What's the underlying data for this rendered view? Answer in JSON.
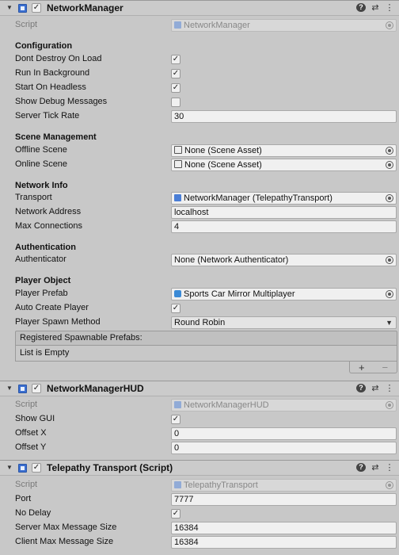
{
  "network_manager": {
    "title": "NetworkManager",
    "script_label": "Script",
    "script_value": "NetworkManager",
    "configuration": {
      "title": "Configuration",
      "dont_destroy_on_load": "Dont Destroy On Load",
      "run_in_background": "Run In Background",
      "start_on_headless": "Start On Headless",
      "show_debug_messages": "Show Debug Messages",
      "server_tick_rate": "Server Tick Rate",
      "server_tick_rate_value": "30",
      "checked_mark": "✓"
    },
    "scene_management": {
      "title": "Scene Management",
      "offline_scene": "Offline Scene",
      "offline_scene_value": "None (Scene Asset)",
      "online_scene": "Online Scene",
      "online_scene_value": "None (Scene Asset)"
    },
    "network_info": {
      "title": "Network Info",
      "transport": "Transport",
      "transport_value": "NetworkManager (TelepathyTransport)",
      "network_address": "Network Address",
      "network_address_value": "localhost",
      "max_connections": "Max Connections",
      "max_connections_value": "4"
    },
    "authentication": {
      "title": "Authentication",
      "authenticator": "Authenticator",
      "authenticator_value": "None (Network Authenticator)"
    },
    "player_object": {
      "title": "Player Object",
      "player_prefab": "Player Prefab",
      "player_prefab_value": "Sports Car Mirror Multiplayer",
      "auto_create_player": "Auto Create Player",
      "player_spawn_method": "Player Spawn Method",
      "player_spawn_method_value": "Round Robin"
    },
    "spawnable_list": {
      "header": "Registered Spawnable Prefabs:",
      "empty": "List is Empty",
      "add": "+",
      "remove": "−"
    }
  },
  "network_manager_hud": {
    "title": "NetworkManagerHUD",
    "script_label": "Script",
    "script_value": "NetworkManagerHUD",
    "show_gui": "Show GUI",
    "offset_x": "Offset X",
    "offset_x_value": "0",
    "offset_y": "Offset Y",
    "offset_y_value": "0"
  },
  "telepathy_transport": {
    "title": "Telepathy Transport (Script)",
    "script_label": "Script",
    "script_value": "TelepathyTransport",
    "port": "Port",
    "port_value": "7777",
    "no_delay": "No Delay",
    "server_max_message_size": "Server Max Message Size",
    "server_max_message_size_value": "16384",
    "client_max_message_size": "Client Max Message Size",
    "client_max_message_size_value": "16384"
  },
  "header_icons": {
    "foldout": "▼",
    "check": "✓",
    "help": "?",
    "settings": "⇄",
    "menu": "⋮"
  }
}
